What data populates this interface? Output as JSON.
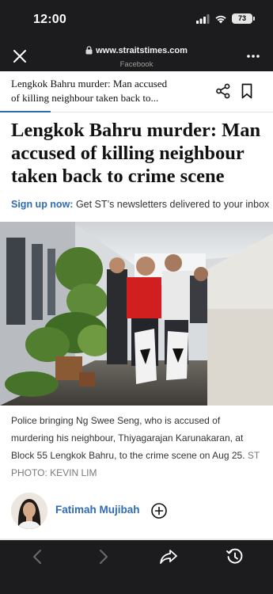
{
  "status": {
    "time": "12:00",
    "battery": "73"
  },
  "browser": {
    "url": "www.straitstimes.com",
    "source": "Facebook"
  },
  "sticky_header": {
    "title_line1": "Lengkok Bahru murder: Man accused",
    "title_line2": "of killing neighbour taken back to..."
  },
  "article": {
    "headline_line1": "Lengkok Bahru murder: Man",
    "headline_line2": "accused of killing neighbour",
    "headline_line3": "taken back to crime scene",
    "signup_link": "Sign up now:",
    "signup_text": " Get ST’s newsletters delivered to your inbox",
    "caption": "Police bringing Ng Swee Seng, who is accused of murdering his neighbour, Thiyagarajan Karunakaran, at Block 55 Lengkok Bahru, to the crime scene on Aug 25. ",
    "photo_credit": "ST PHOTO: KEVIN LIM"
  },
  "author": {
    "name": "Fatimah Mujibah"
  },
  "colors": {
    "accent": "#2f6cb3",
    "chrome": "#1c1c1e",
    "headline": "#111111"
  }
}
